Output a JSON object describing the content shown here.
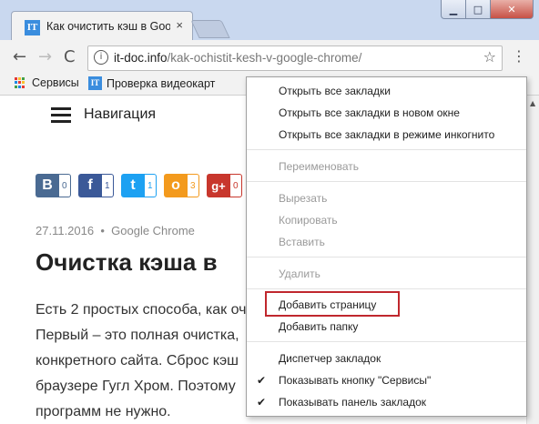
{
  "window": {
    "min_icon": "minimize-icon",
    "max_icon": "maximize-icon",
    "close_icon": "close-icon",
    "min_glyph": "▁",
    "max_glyph": "□",
    "close_glyph": "✕"
  },
  "tab": {
    "favicon_text": "IT",
    "title": "Как очистить кэш в Goo",
    "close_glyph": "×"
  },
  "toolbar": {
    "back": "←",
    "forward": "→",
    "reload": "C",
    "info_glyph": "i",
    "url_host": "it-doc.info",
    "url_path": "/kak-ochistit-kesh-v-google-chrome/",
    "star": "☆",
    "menu": "⋮"
  },
  "bookmarks": [
    {
      "label": "Сервисы"
    },
    {
      "label": "Проверка видеокарт",
      "favicon_text": "IT"
    }
  ],
  "page": {
    "nav_label": "Навигация",
    "share": [
      {
        "icon": "В",
        "count": "0",
        "color": "#4a6a92"
      },
      {
        "icon": "f",
        "count": "1",
        "color": "#3b5998"
      },
      {
        "icon": "t",
        "count": "1",
        "color": "#1da1f2"
      },
      {
        "icon": "о",
        "count": "3",
        "color": "#f39a1d"
      },
      {
        "icon": "g+",
        "count": "0",
        "color": "#c8372d"
      }
    ],
    "date": "27.11.2016",
    "bullet": "•",
    "category": "Google Chrome",
    "title": "Очистка кэша в",
    "paragraph_lines": [
      "Есть 2 простых способа, как оч",
      "Первый – это полная очистка,",
      "конкретного сайта. Сброс кэш",
      "браузере Гугл Хром. Поэтому",
      "программ не нужно."
    ]
  },
  "context_menu": {
    "items": [
      {
        "label": "Открыть все закладки",
        "disabled": false
      },
      {
        "label": "Открыть все закладки в новом окне",
        "disabled": false
      },
      {
        "label": "Открыть все закладки в режиме инкогнито",
        "disabled": false
      },
      {
        "label": "Переименовать",
        "disabled": true
      },
      {
        "label": "Вырезать",
        "disabled": true
      },
      {
        "label": "Копировать",
        "disabled": true
      },
      {
        "label": "Вставить",
        "disabled": true
      },
      {
        "label": "Удалить",
        "disabled": true
      },
      {
        "label": "Добавить страницу",
        "disabled": false,
        "highlighted": true
      },
      {
        "label": "Добавить папку",
        "disabled": false
      },
      {
        "label": "Диспетчер закладок",
        "disabled": false
      },
      {
        "label": "Показывать кнопку \"Сервисы\"",
        "disabled": false,
        "checked": true
      },
      {
        "label": "Показывать панель закладок",
        "disabled": false,
        "checked": true
      }
    ],
    "check_glyph": "✔"
  }
}
